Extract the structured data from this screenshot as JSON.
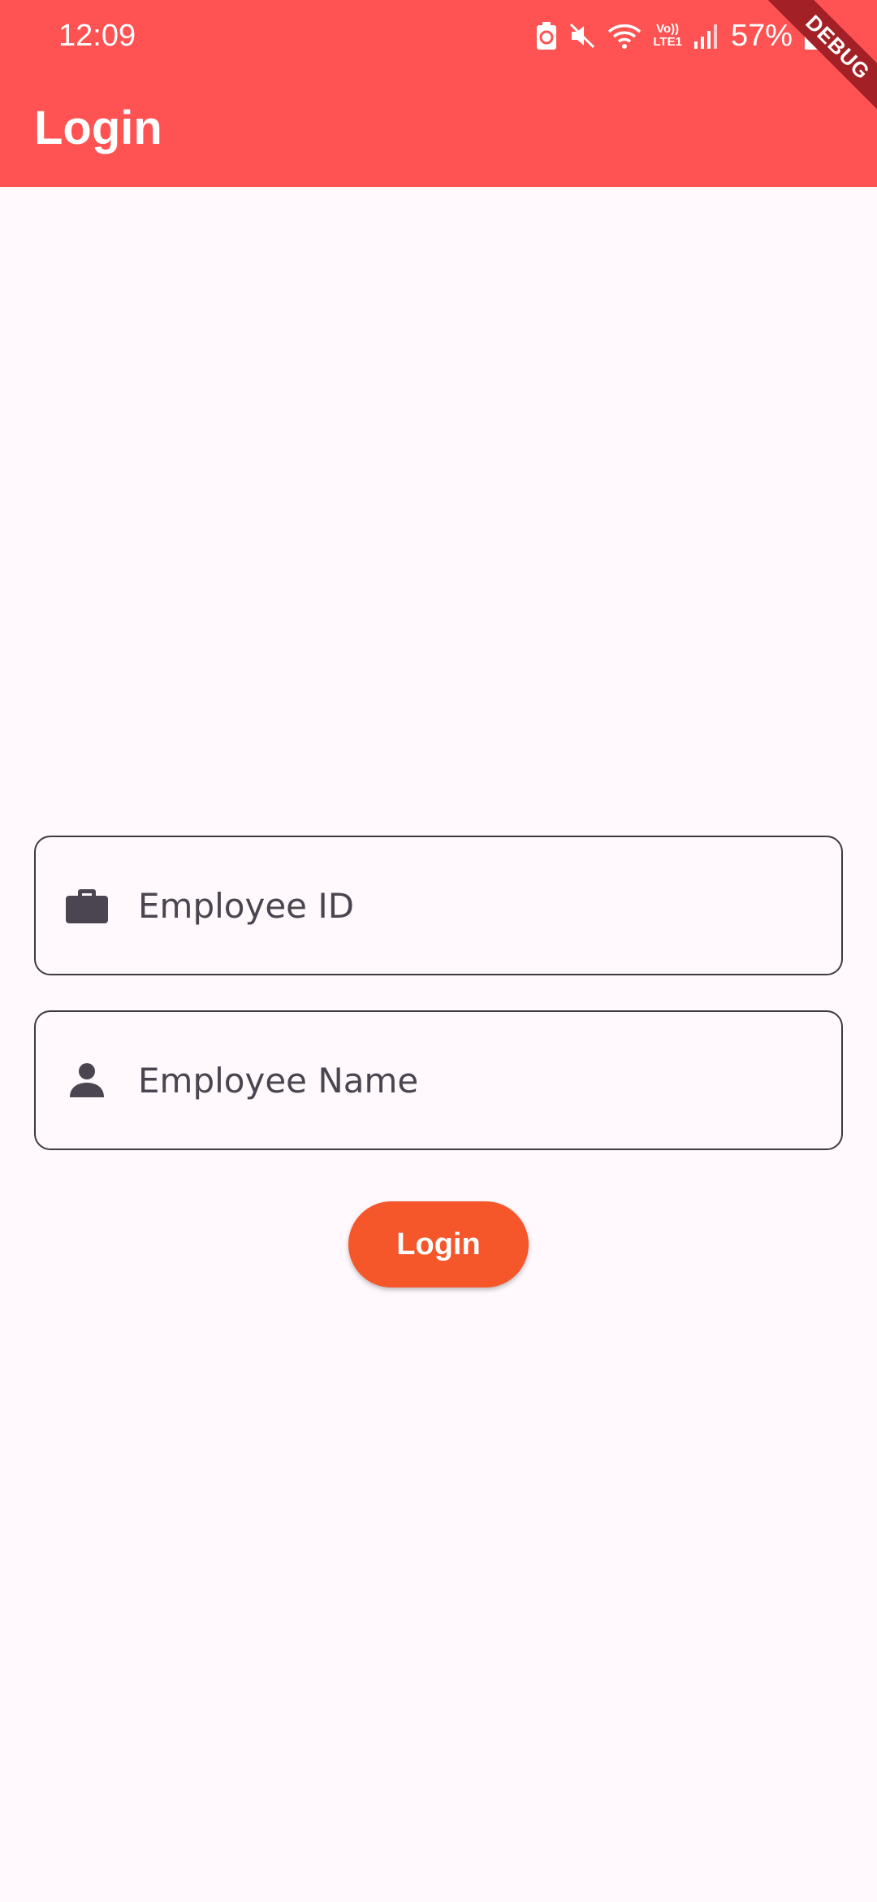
{
  "status_bar": {
    "time": "12:09",
    "battery_percent": "57%",
    "volte_label_top": "Vo))",
    "volte_label_bottom": "LTE1",
    "icons": [
      "battery-saver-icon",
      "mute-icon",
      "wifi-icon",
      "volte-icon",
      "signal-icon",
      "battery-icon"
    ]
  },
  "debug_banner": "DEBUG",
  "app_bar": {
    "title": "Login",
    "color": "#ff5252"
  },
  "form": {
    "employee_id": {
      "placeholder": "Employee ID",
      "value": "",
      "icon": "briefcase-icon"
    },
    "employee_name": {
      "placeholder": "Employee Name",
      "value": "",
      "icon": "person-icon"
    },
    "login_button_label": "Login",
    "login_button_color": "#f5572b"
  }
}
